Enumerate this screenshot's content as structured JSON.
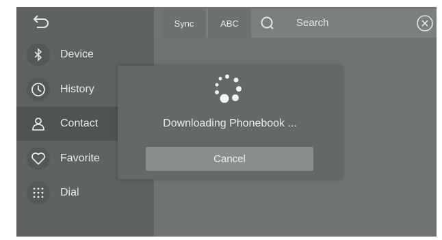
{
  "toolbar": {
    "sync_label": "Sync",
    "abc_label": "ABC",
    "search_placeholder": "Search"
  },
  "sidebar": {
    "items": [
      {
        "label": "Device",
        "icon": "bluetooth-icon"
      },
      {
        "label": "History",
        "icon": "clock-icon"
      },
      {
        "label": "Contact",
        "icon": "person-icon",
        "active": true
      },
      {
        "label": "Favorite",
        "icon": "heart-icon"
      },
      {
        "label": "Dial",
        "icon": "dialpad-icon"
      }
    ]
  },
  "dialog": {
    "message": "Downloading Phonebook ...",
    "cancel_label": "Cancel"
  },
  "colors": {
    "sidebar_bg": "#5e635f",
    "active_item_bg": "#4f5450",
    "dialog_bg": "#646965",
    "button_bg": "#8b8f8b",
    "text": "#e6e9e6"
  }
}
